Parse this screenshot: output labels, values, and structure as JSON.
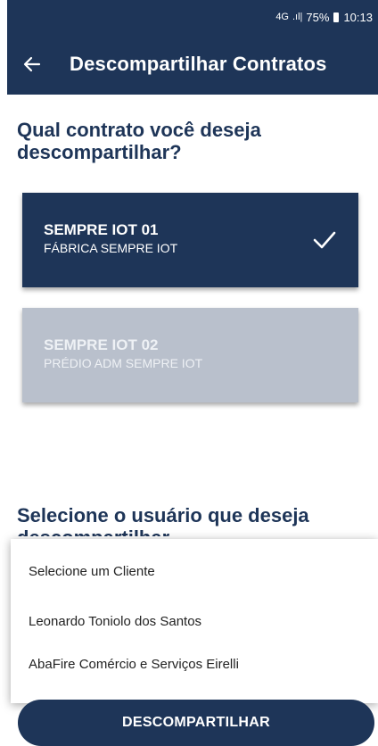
{
  "status_bar": {
    "network": "4G",
    "battery": "75%",
    "time": "10:13"
  },
  "app_bar": {
    "title": "Descompartilhar Contratos",
    "back_icon": "arrow-left-icon"
  },
  "question": "Qual contrato você deseja descompartilhar?",
  "contracts": [
    {
      "name": "SEMPRE IOT 01",
      "location": "FÁBRICA SEMPRE IOT",
      "selected": true,
      "icon": "check-icon"
    },
    {
      "name": "SEMPRE IOT 02",
      "location": "PRÉDIO ADM SEMPRE IOT",
      "selected": false
    }
  ],
  "user_section": {
    "heading": "Selecione o usuário que deseja descompartilhar"
  },
  "dropdown": {
    "options": [
      "Selecione um Cliente",
      "Leonardo Toniolo dos Santos",
      "AbaFire Comércio e Serviços Eirelli"
    ]
  },
  "action": {
    "label": "DESCOMPARTILHAR"
  },
  "colors": {
    "primary": "#1e3558",
    "card_disabled": "#b9c0cc",
    "background": "#ffffff"
  }
}
